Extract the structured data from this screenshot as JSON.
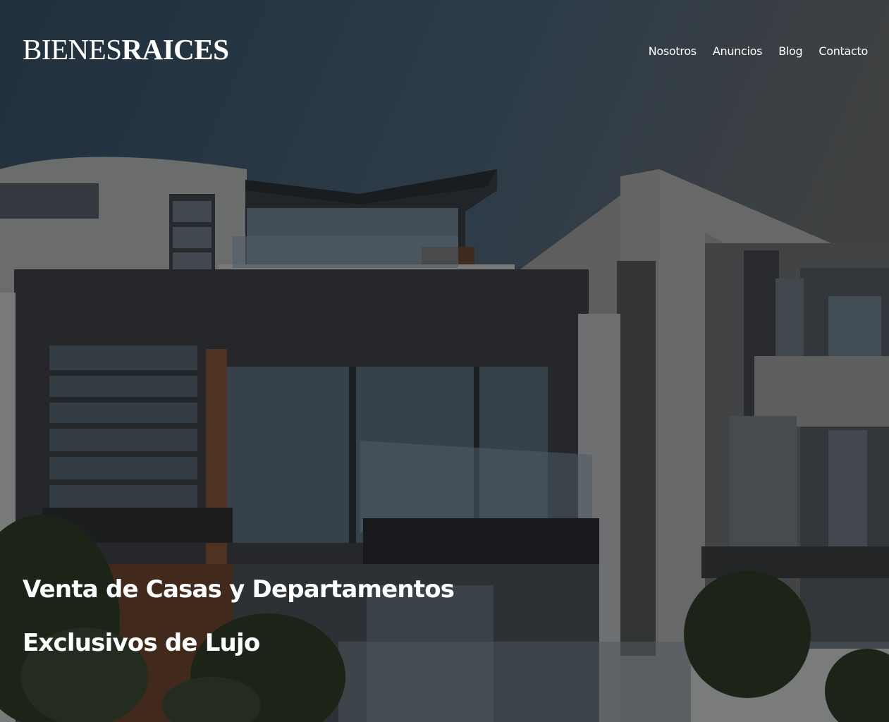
{
  "brand": {
    "light": "BIENES",
    "strong": "RAICES"
  },
  "nav": {
    "items": [
      {
        "label": "Nosotros"
      },
      {
        "label": "Anuncios"
      },
      {
        "label": "Blog"
      },
      {
        "label": "Contacto"
      }
    ]
  },
  "hero": {
    "title": "Venta de Casas y Departamentos",
    "subtitle": "Exclusivos de Lujo",
    "image": "modern-house-photo"
  },
  "colors": {
    "text": "#ffffff",
    "sky_top": "#2b3b4a",
    "sky_right": "#4a4a4a"
  }
}
